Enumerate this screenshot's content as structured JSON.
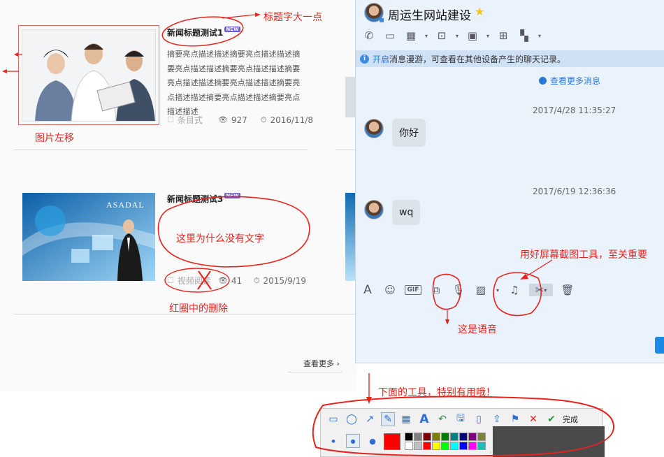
{
  "news": {
    "item1": {
      "title": "新闻标题测试1",
      "new_tag": "NEW",
      "desc": [
        "摘要亮点描述描述摘要亮点描述描述摘",
        "要亮点描述描述摘要亮点描述描述摘要",
        "亮点描述描述摘要亮点描述描述摘要亮",
        "点描述描述摘要亮点描述描述摘要亮点",
        "描述描述"
      ],
      "category": "条目式",
      "views": "927",
      "date": "2016/11/8"
    },
    "item2": {
      "title": "新闻标题测试3",
      "new_tag": "NEW",
      "category": "视频阅读",
      "views": "41",
      "date": "2015/9/19",
      "image_text": "ASADAL"
    },
    "more": "查看更多"
  },
  "chat": {
    "contact_name": "周运生网站建设",
    "info_prefix": "开启",
    "info_text": "消息漫游，可查看在其他设备产生的聊天记录。",
    "more_messages": "查看更多消息",
    "messages": [
      {
        "time": "2017/4/28 11:35:27",
        "text": "你好"
      },
      {
        "time": "2017/6/19 12:36:36",
        "text": "wq"
      }
    ],
    "gif_label": "GIF"
  },
  "screenshot_toolbar": {
    "done_label": "完成",
    "colors_row1": [
      "#000000",
      "#808080",
      "#800000",
      "#808000",
      "#008000",
      "#008080",
      "#000080",
      "#800080",
      "#808040"
    ],
    "colors_row2": [
      "#ffffff",
      "#c0c0c0",
      "#ff0000",
      "#ffff00",
      "#00ff00",
      "#00ffff",
      "#0000ff",
      "#ff00ff",
      "#22bbbb"
    ],
    "selected_color": "#ff0000"
  },
  "annotations": {
    "title_bigger": "标题字大一点",
    "image_left": "图片左移",
    "why_no_text": "这里为什么没有文字",
    "remove_circled": "红圈中的删除",
    "voice": "这是语音",
    "screenshot_tool": "用好屏幕截图工具，至关重要",
    "tools_useful": "下面的工具，特别有用哦！"
  }
}
